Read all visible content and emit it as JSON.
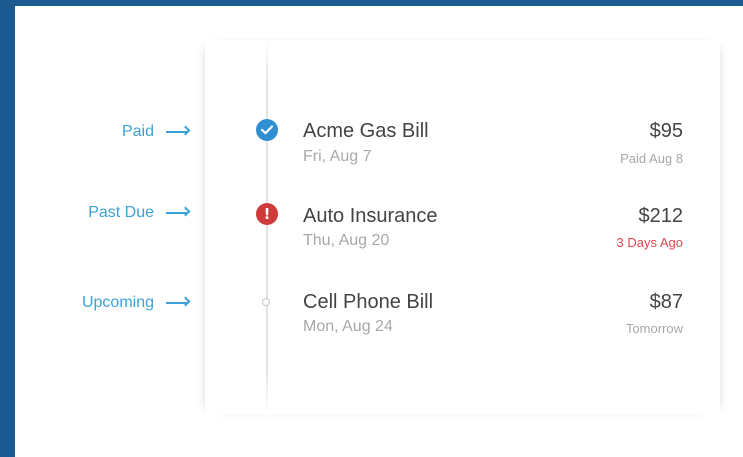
{
  "legend": [
    {
      "label": "Paid"
    },
    {
      "label": "Past Due"
    },
    {
      "label": "Upcoming"
    }
  ],
  "bills": [
    {
      "name": "Acme Gas Bill",
      "date": "Fri, Aug 7",
      "amount": "$95",
      "status_text": "Paid Aug 8",
      "status": "paid",
      "icon": "check-circle-icon"
    },
    {
      "name": "Auto Insurance",
      "date": "Thu, Aug 20",
      "amount": "$212",
      "status_text": "3 Days Ago",
      "status": "past-due",
      "icon": "exclamation-circle-icon",
      "icon_glyph": "!"
    },
    {
      "name": "Cell Phone Bill",
      "date": "Mon, Aug 24",
      "amount": "$87",
      "status_text": "Tomorrow",
      "status": "upcoming",
      "icon": "empty-circle-icon"
    }
  ],
  "colors": {
    "frame": "#1b5a91",
    "accent": "#3ba2d8",
    "paid": "#2f8fd0",
    "past_due": "#d13a3a",
    "past_due_text": "#e0454f",
    "primary_text": "#444444",
    "secondary_text": "#a8a8a8"
  }
}
